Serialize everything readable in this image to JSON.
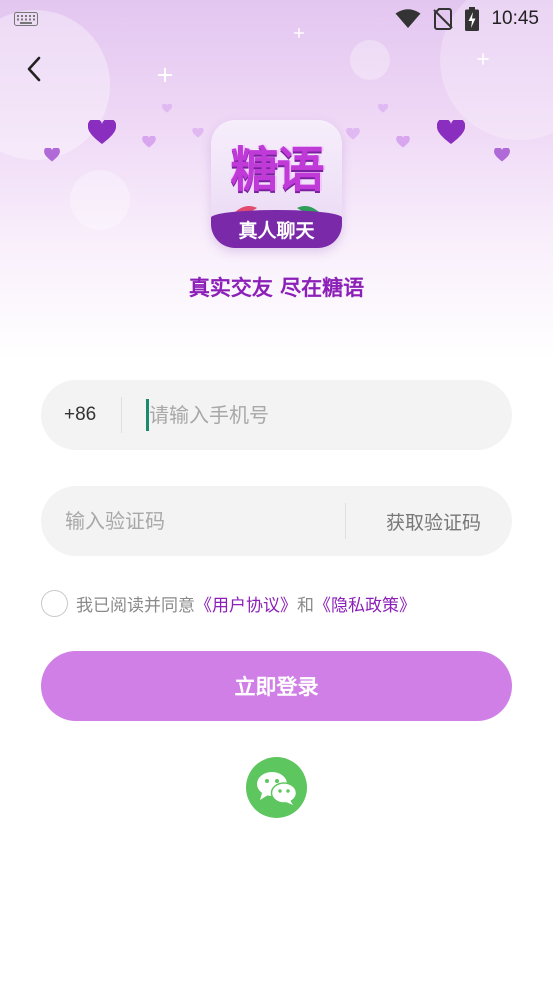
{
  "status_bar": {
    "time": "10:45",
    "icons": [
      "keyboard-icon",
      "wifi-icon",
      "no-sim-icon",
      "battery-charging-icon"
    ]
  },
  "header": {
    "back_icon": "chevron-left-icon"
  },
  "logo": {
    "title": "糖语",
    "subtitle": "真人聊天"
  },
  "slogan": "真实交友 尽在糖语",
  "phone_field": {
    "country_code": "+86",
    "placeholder": "请输入手机号",
    "value": ""
  },
  "code_field": {
    "placeholder": "输入验证码",
    "value": "",
    "get_code_label": "获取验证码"
  },
  "agreement": {
    "checked": false,
    "prefix": "我已阅读并同意",
    "user_agreement": "《用户协议》",
    "conjunction": "和",
    "privacy_policy": "《隐私政策》"
  },
  "login_button": "立即登录",
  "social_login": {
    "icon": "wechat-icon"
  },
  "colors": {
    "accent": "#8b1fb8",
    "button": "#d07fe6",
    "wechat": "#5ec65e",
    "field_bg": "#f3f3f3"
  }
}
